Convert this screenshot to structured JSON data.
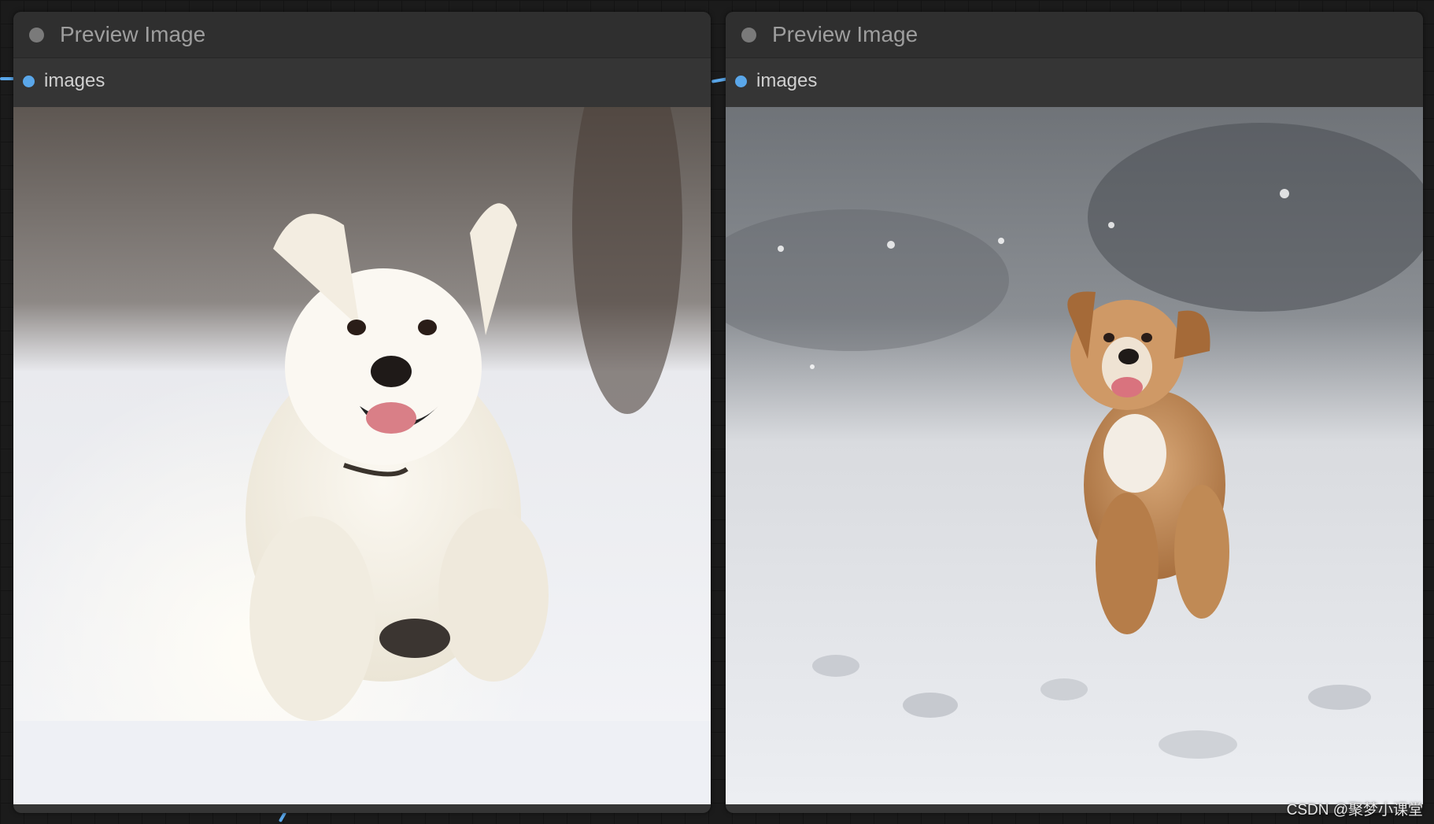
{
  "nodes": [
    {
      "title": "Preview Image",
      "input_label": "images"
    },
    {
      "title": "Preview Image",
      "input_label": "images"
    }
  ],
  "watermark": "CSDN @聚梦小课堂",
  "colors": {
    "slot": "#5aa7ea",
    "node_bg": "#353535",
    "canvas": "#1b1b1b"
  }
}
